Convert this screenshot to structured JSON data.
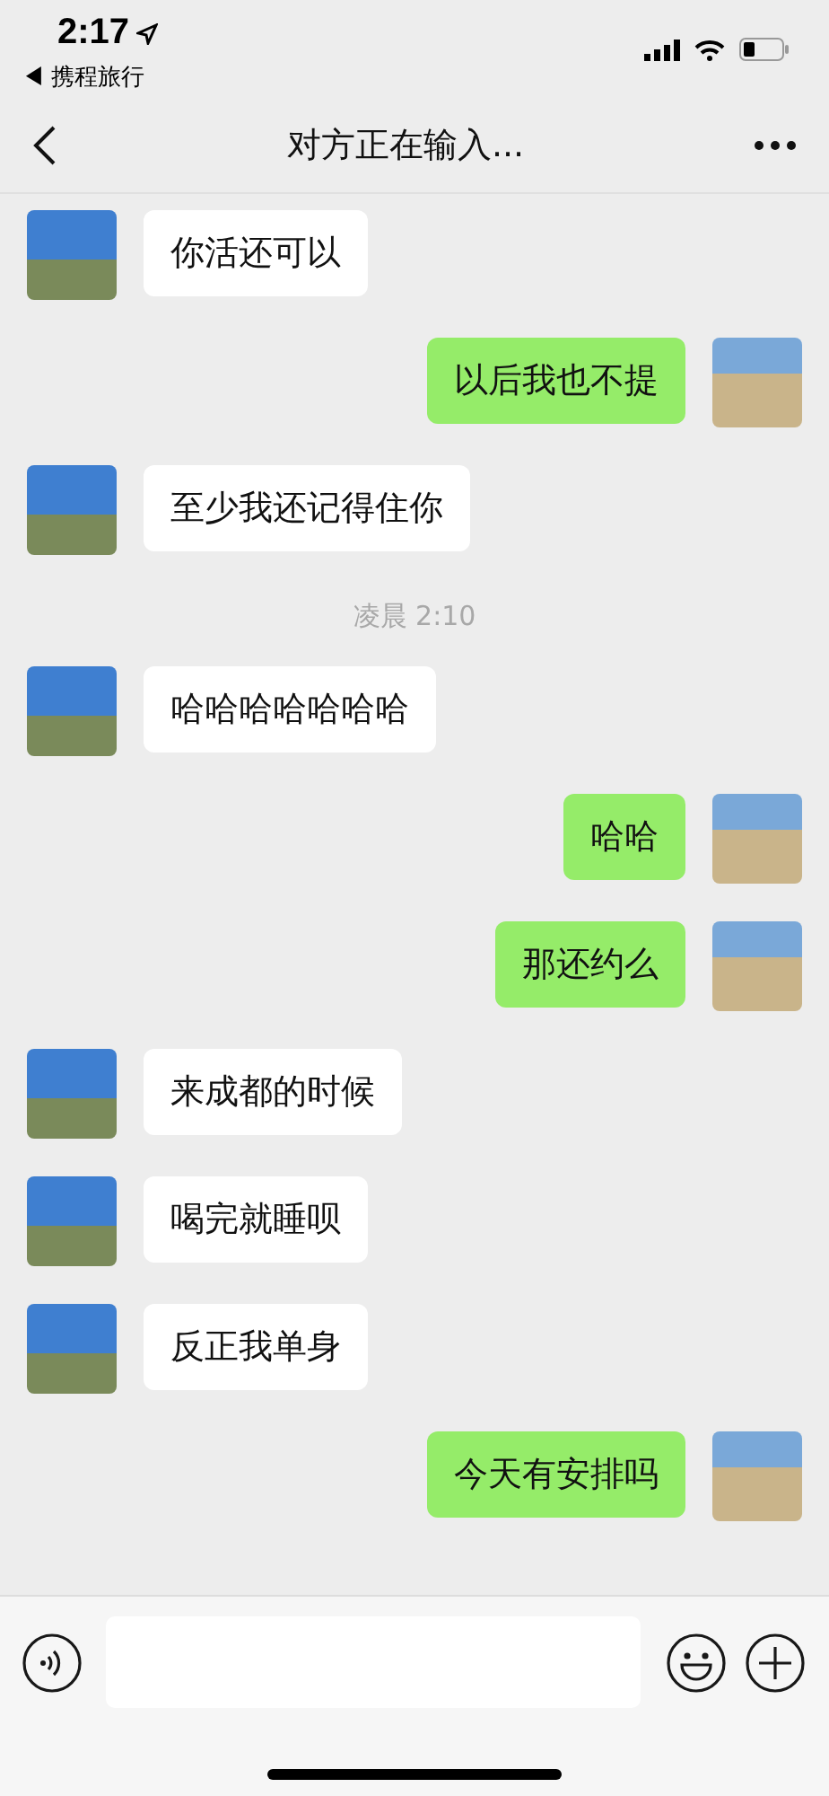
{
  "status_bar": {
    "time": "2:17",
    "back_app": "◀ 携程旅行"
  },
  "nav": {
    "title": "对方正在输入..."
  },
  "messages": [
    {
      "kind": "incoming",
      "text": "你活还可以"
    },
    {
      "kind": "outgoing",
      "text": "以后我也不提"
    },
    {
      "kind": "incoming",
      "text": "至少我还记得住你"
    },
    {
      "kind": "time",
      "text": "凌晨 2:10"
    },
    {
      "kind": "incoming",
      "text": "哈哈哈哈哈哈哈"
    },
    {
      "kind": "outgoing",
      "text": "哈哈"
    },
    {
      "kind": "outgoing",
      "text": "那还约么"
    },
    {
      "kind": "incoming",
      "text": "来成都的时候"
    },
    {
      "kind": "incoming",
      "text": "喝完就睡呗"
    },
    {
      "kind": "incoming",
      "text": "反正我单身"
    },
    {
      "kind": "outgoing",
      "text": "今天有安排吗"
    }
  ]
}
